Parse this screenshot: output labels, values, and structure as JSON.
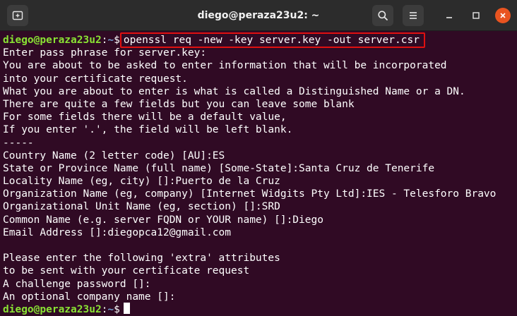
{
  "window": {
    "title": "diego@peraza23u2: ~",
    "icons": {
      "new_tab": "new-tab-icon",
      "search": "search-icon",
      "menu": "hamburger-menu-icon",
      "minimize": "minimize-icon",
      "maximize": "maximize-icon",
      "close": "close-icon"
    },
    "colors": {
      "titlebar": "#2c2c2c",
      "background": "#300a24",
      "prompt_user": "#8ae234",
      "prompt_path": "#729fcf",
      "highlight": "#e01010",
      "close_button": "#e95420"
    }
  },
  "terminal": {
    "prompt": {
      "user_host": "diego@peraza23u2",
      "colon": ":",
      "path": "~",
      "symbol": "$"
    },
    "command": "openssl req -new -key server.key -out server.csr",
    "output": [
      "Enter pass phrase for server.key:",
      "You are about to be asked to enter information that will be incorporated",
      "into your certificate request.",
      "What you are about to enter is what is called a Distinguished Name or a DN.",
      "There are quite a few fields but you can leave some blank",
      "For some fields there will be a default value,",
      "If you enter '.', the field will be left blank.",
      "-----",
      "Country Name (2 letter code) [AU]:ES",
      "State or Province Name (full name) [Some-State]:Santa Cruz de Tenerife",
      "Locality Name (eg, city) []:Puerto de la Cruz",
      "Organization Name (eg, company) [Internet Widgits Pty Ltd]:IES - Telesforo Bravo",
      "Organizational Unit Name (eg, section) []:SRD",
      "Common Name (e.g. server FQDN or YOUR name) []:Diego",
      "Email Address []:diegopca12@gmail.com",
      "",
      "Please enter the following 'extra' attributes",
      "to be sent with your certificate request",
      "A challenge password []:",
      "An optional company name []:"
    ]
  }
}
